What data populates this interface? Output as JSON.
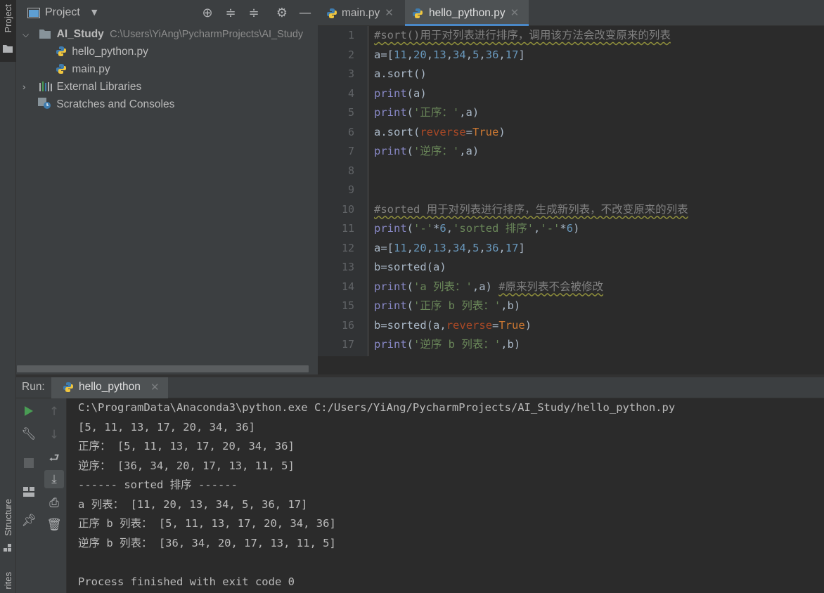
{
  "side_stripe": {
    "project_label": "Project",
    "structure_label": "Structure",
    "favorites_label": "rites"
  },
  "project_panel": {
    "title": "Project",
    "root": {
      "name": "AI_Study",
      "path": "C:\\Users\\YiAng\\PycharmProjects\\AI_Study"
    },
    "files": [
      "hello_python.py",
      "main.py"
    ],
    "external_libraries": "External Libraries",
    "scratches": "Scratches and Consoles"
  },
  "editor": {
    "tabs": [
      {
        "label": "main.py",
        "active": false
      },
      {
        "label": "hello_python.py",
        "active": true
      }
    ],
    "line_numbers": [
      "1",
      "2",
      "3",
      "4",
      "5",
      "6",
      "7",
      "8",
      "9",
      "10",
      "11",
      "12",
      "13",
      "14",
      "15",
      "16",
      "17"
    ],
    "code": {
      "l1": "#sort()用于对列表进行排序，调用该方法会改变原来的列表",
      "l2_a": "a=[",
      "l2_n": [
        "11",
        "20",
        "13",
        "34",
        "5",
        "36",
        "17"
      ],
      "l2_close": "]",
      "comma": ",",
      "l3": "a.sort()",
      "print": "print",
      "sort": "a.sort(",
      "sorted": "sorted",
      "l4_args": "(a)",
      "l5_str": "'正序：'",
      "l6_kw": "reverse",
      "l6_eq": "=",
      "l6_true": "True",
      "paren_close": ")",
      "l7_str": "'逆序：'",
      "l10": "#sorted 用于对列表进行排序，生成新列表，不改变原来的列表",
      "l11_str1": "'-'",
      "l11_star": "*",
      "l11_n": "6",
      "l11_str2": "'sorted 排序'",
      "l13_b": "b=",
      "l13_args": "(a)",
      "l14_str": "'a 列表：'",
      "l14_comment": "#原来列表不会被修改",
      "l15_str": "'正序 b 列表：'",
      "var_a": "a",
      "var_b": "b",
      "l17_str": "'逆序 b 列表：'"
    }
  },
  "run_panel": {
    "label": "Run:",
    "tab": "hello_python",
    "output": [
      "C:\\ProgramData\\Anaconda3\\python.exe C:/Users/YiAng/PycharmProjects/AI_Study/hello_python.py",
      "[5, 11, 13, 17, 20, 34, 36]",
      "正序： [5, 11, 13, 17, 20, 34, 36]",
      "逆序： [36, 34, 20, 17, 13, 11, 5]",
      "------ sorted 排序 ------",
      "a 列表： [11, 20, 13, 34, 5, 36, 17]",
      "正序 b 列表： [5, 11, 13, 17, 20, 34, 36]",
      "逆序 b 列表： [36, 34, 20, 17, 13, 11, 5]",
      "",
      "Process finished with exit code 0"
    ]
  },
  "colors": {
    "accent": "#4a88c7",
    "run_green": "#499c54",
    "background": "#2b2b2b",
    "panel": "#3c3f41"
  }
}
